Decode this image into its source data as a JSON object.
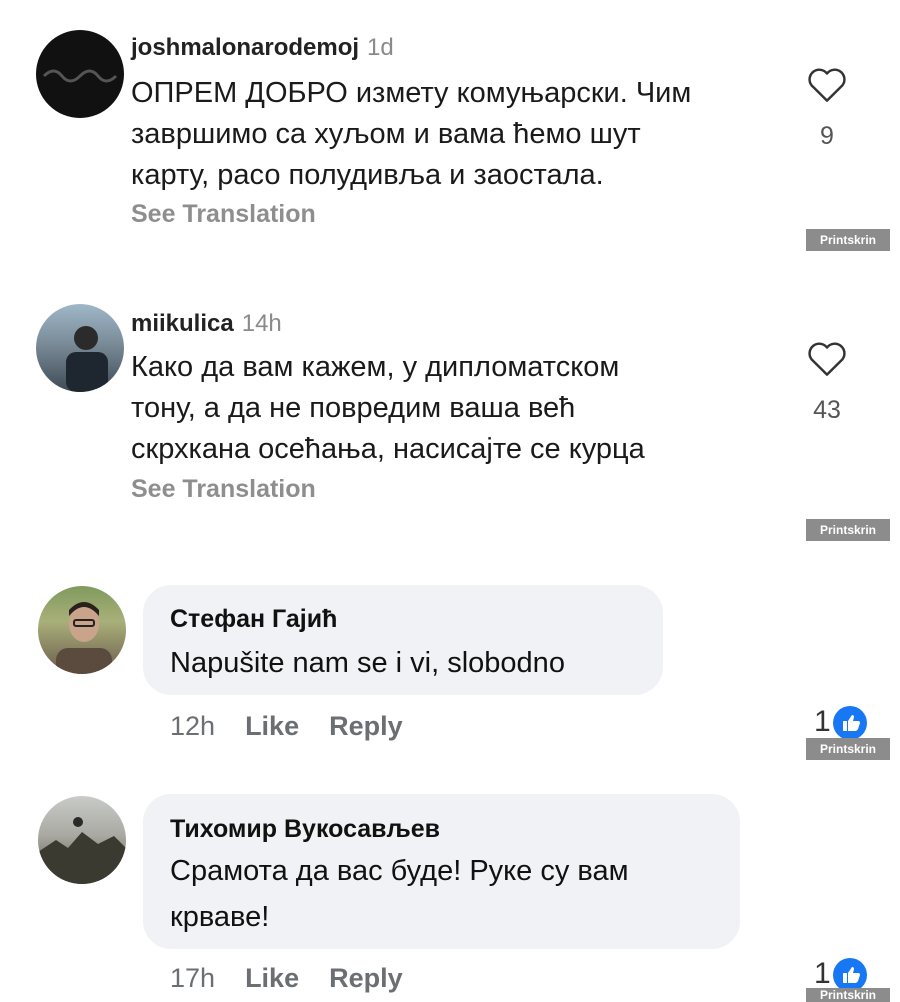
{
  "comments": [
    {
      "username": "joshmalonarodemoj",
      "time": "1d",
      "lines": [
        "ОПРЕМ ДОБРО измету комуњарски. Чим",
        "завршимо са хуљом и вама ћемо шут",
        "карту, расо полудивља и заостала."
      ],
      "see_translation": "See Translation",
      "likes": "9",
      "watermark": "Printskrin"
    },
    {
      "username": "miikulica",
      "time": "14h",
      "lines": [
        "Како да вам кажем, у дипломатском",
        "тону, а да не повредим ваша већ",
        "скрхкана осећања, насисајте се курца"
      ],
      "see_translation": "See Translation",
      "likes": "43",
      "watermark": "Printskrin"
    }
  ],
  "fb_comments": [
    {
      "name": "Стефан Гајић",
      "lines": [
        "Napušite nam se i vi, slobodno"
      ],
      "time": "12h",
      "like": "Like",
      "reply": "Reply",
      "reactions": "1",
      "watermark": "Printskrin"
    },
    {
      "name": "Тихомир Вукосављев",
      "lines": [
        "Срамота да вас буде! Руке су вам",
        "крваве!"
      ],
      "time": "17h",
      "like": "Like",
      "reply": "Reply",
      "reactions": "1",
      "watermark": "Printskrin"
    }
  ],
  "icons": {
    "like": "heart-icon",
    "reaction": "thumbs-up-icon"
  },
  "colors": {
    "fb_blue": "#1877f2",
    "bubble": "#f0f2f5",
    "watermark": "#8c8c8c"
  }
}
